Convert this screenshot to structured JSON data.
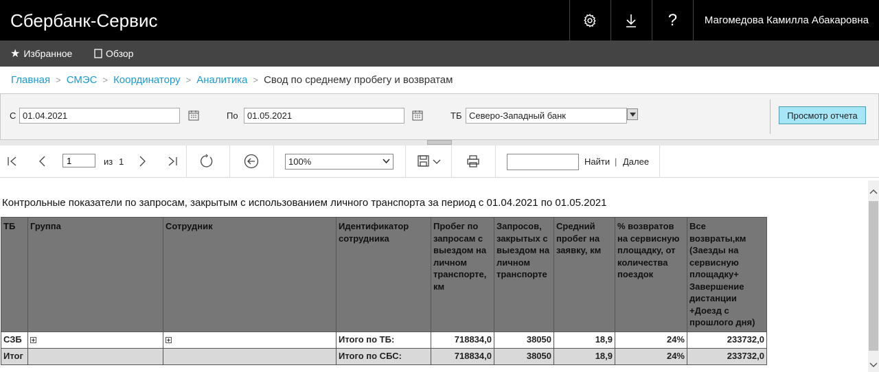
{
  "header": {
    "app_title": "Сбербанк-Сервис",
    "user_name": "Магомедова Камилла Абакаровна",
    "icons": [
      "gear-icon",
      "download-icon",
      "help-icon"
    ],
    "help_glyph": "?"
  },
  "subnav": {
    "favorites": "Избранное",
    "overview": "Обзор"
  },
  "breadcrumb": {
    "items": [
      "Главная",
      "СМЭС",
      "Координатору",
      "Аналитика"
    ],
    "current": "Свод по среднему пробегу и возвратам"
  },
  "params": {
    "from_label": "С",
    "from_value": "01.04.2021",
    "to_label": "По",
    "to_value": "01.05.2021",
    "tb_label": "ТБ",
    "tb_value": "Северо-Западный банк",
    "view_button": "Просмотр отчета"
  },
  "toolbar": {
    "page_value": "1",
    "of_label": "из",
    "total_pages": "1",
    "zoom_value": "100%",
    "find_label": "Найти",
    "separator": "|",
    "next_label": "Далее"
  },
  "report": {
    "title": "Контрольные показатели по запросам, закрытым с использованием личного транспорта за период с 01.04.2021 по 01.05.2021",
    "columns": [
      "ТБ",
      "Группа",
      "Сотрудник",
      "Идентификатор сотрудника",
      "Пробег по запросам с выездом на личном транспорте, км",
      "Запросов, закрытых с выездом на личном транспорте",
      "Средний пробег на заявку, км",
      "% возвратов на сервисную площадку, от количества поездок",
      "Все возвраты,км (Заезды на сервисную площадку+ Завершение дистанции +Доезд с прошлого дня)"
    ],
    "rows": [
      {
        "tb": "СЗБ",
        "group": "",
        "employee": "",
        "id": "Итого по ТБ:",
        "mileage": "718834,0",
        "requests": "38050",
        "avg": "18,9",
        "pct": "24%",
        "returns": "233732,0"
      },
      {
        "tb": "Итог",
        "group": "",
        "employee": "",
        "id": "Итого по СБС:",
        "mileage": "718834,0",
        "requests": "38050",
        "avg": "18,9",
        "pct": "24%",
        "returns": "233732,0"
      }
    ]
  },
  "colors": {
    "topbar": "#000000",
    "subbar": "#444444",
    "link": "#1a9ad6",
    "view_button": "#a7e6f7",
    "table_header": "#777777",
    "total_row": "#d9d9d9"
  }
}
